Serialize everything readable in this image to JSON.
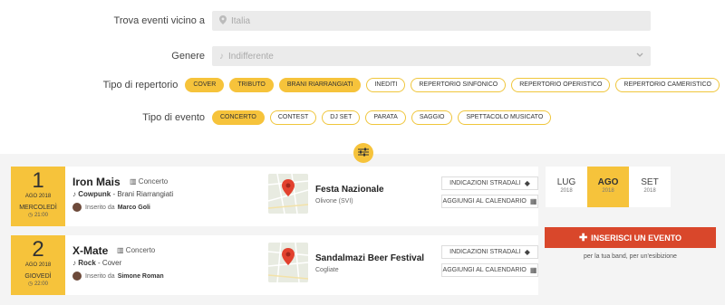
{
  "filters": {
    "location": {
      "label": "Trova eventi vicino a",
      "placeholder": "Italia"
    },
    "genre": {
      "label": "Genere",
      "value": "Indifferente"
    },
    "repertoire": {
      "label": "Tipo di repertorio",
      "options": [
        {
          "label": "COVER",
          "selected": true
        },
        {
          "label": "TRIBUTO",
          "selected": true
        },
        {
          "label": "BRANI RIARRANGIATI",
          "selected": true
        },
        {
          "label": "INEDITI",
          "selected": false
        },
        {
          "label": "REPERTORIO SINFONICO",
          "selected": false
        },
        {
          "label": "REPERTORIO OPERISTICO",
          "selected": false
        },
        {
          "label": "REPERTORIO CAMERISTICO",
          "selected": false
        }
      ]
    },
    "event_type": {
      "label": "Tipo di evento",
      "options": [
        {
          "label": "CONCERTO",
          "selected": true
        },
        {
          "label": "CONTEST",
          "selected": false
        },
        {
          "label": "DJ SET",
          "selected": false
        },
        {
          "label": "PARATA",
          "selected": false
        },
        {
          "label": "SAGGIO",
          "selected": false
        },
        {
          "label": "SPETTACOLO MUSICATO",
          "selected": false
        }
      ]
    }
  },
  "events": [
    {
      "day": "1",
      "month_year": "AGO 2018",
      "weekday": "MERCOLEDÌ",
      "time": "21:00",
      "title": "Iron Mais",
      "type": "Concerto",
      "genre": "Cowpunk",
      "genre_detail": "- Brani Riarrangiati",
      "posted_by_label": "Inserito da",
      "posted_by": "Marco Goli",
      "venue": "Festa Nazionale",
      "town": "Olivone (SVI)",
      "directions": "INDICAZIONI STRADALI",
      "calendar": "AGGIUNGI AL CALENDARIO"
    },
    {
      "day": "2",
      "month_year": "AGO 2018",
      "weekday": "GIOVEDÌ",
      "time": "22:00",
      "title": "X-Mate",
      "type": "Concerto",
      "genre": "Rock",
      "genre_detail": "- Cover",
      "posted_by_label": "Inserito da",
      "posted_by": "Simone Roman",
      "venue": "Sandalmazi Beer Festival",
      "town": "Cogliate",
      "directions": "INDICAZIONI STRADALI",
      "calendar": "AGGIUNGI AL CALENDARIO"
    }
  ],
  "months": [
    {
      "name": "LUG",
      "year": "2018",
      "active": false
    },
    {
      "name": "AGO",
      "year": "2018",
      "active": true
    },
    {
      "name": "SET",
      "year": "2018",
      "active": false
    }
  ],
  "insert": {
    "label": "INSERISCI UN EVENTO",
    "subtitle": "per la tua band, per un'esibizione"
  },
  "colors": {
    "accent": "#f6c33b",
    "cta": "#d9472b",
    "background": "#f4f4f4"
  },
  "icons": {
    "location": "map-pin-icon",
    "genre": "music-note-icon",
    "filters": "sliders-icon",
    "directions": "directions-icon",
    "calendar": "calendar-add-icon",
    "insert": "plus-icon"
  }
}
